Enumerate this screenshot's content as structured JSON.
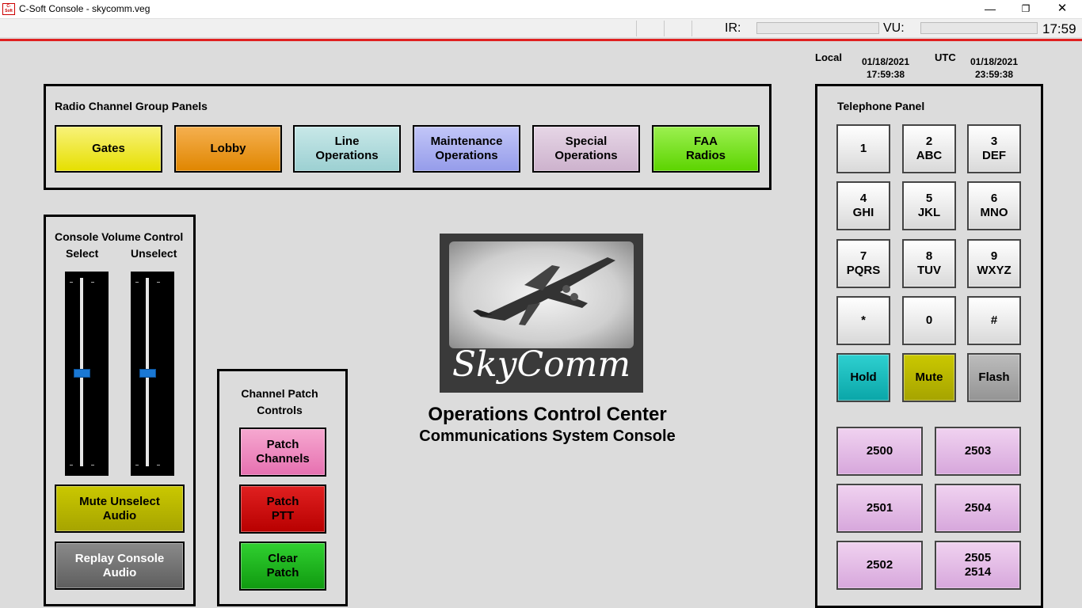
{
  "window": {
    "title": "C-Soft Console - skycomm.veg",
    "icon_text": "C-Soft"
  },
  "statusbar": {
    "ir_label": "IR:",
    "vu_label": "VU:",
    "time": "17:59"
  },
  "clocks": {
    "local_label": "Local",
    "local_date": "01/18/2021",
    "local_time": "17:59:38",
    "utc_label": "UTC",
    "utc_date": "01/18/2021",
    "utc_time": "23:59:38"
  },
  "radio_panel": {
    "title": "Radio Channel Group Panels",
    "buttons": [
      {
        "label": "Gates",
        "color": "#f0ea00"
      },
      {
        "label": "Lobby",
        "color": "#e88d00"
      },
      {
        "label": "Line\nOperations",
        "color": "#a8d8da"
      },
      {
        "label": "Maintenance\nOperations",
        "color": "#a0a6f0"
      },
      {
        "label": "Special\nOperations",
        "color": "#d8c0d8"
      },
      {
        "label": "FAA\nRadios",
        "color": "#6ee010"
      }
    ]
  },
  "volume_panel": {
    "title": "Console Volume Control",
    "select_label": "Select",
    "unselect_label": "Unselect",
    "mute_unselect_label": "Mute Unselect\nAudio",
    "replay_label": "Replay Console\nAudio"
  },
  "patch_panel": {
    "title": "Channel Patch\nControls",
    "patch_channels_label": "Patch\nChannels",
    "patch_ptt_label": "Patch\nPTT",
    "clear_patch_label": "Clear\nPatch"
  },
  "center": {
    "logo_text": "SkyComm",
    "title": "Operations Control Center",
    "subtitle": "Communications System Console"
  },
  "telephone_panel": {
    "title": "Telephone Panel",
    "keys": [
      "1",
      "2\nABC",
      "3\nDEF",
      "4\nGHI",
      "5\nJKL",
      "6\nMNO",
      "7\nPQRS",
      "8\nTUV",
      "9\nWXYZ",
      "*",
      "0",
      "#"
    ],
    "hold_label": "Hold",
    "mute_label": "Mute",
    "flash_label": "Flash",
    "extensions": [
      "2500",
      "2503",
      "2501",
      "2504",
      "2502",
      "2505\n2514"
    ]
  }
}
